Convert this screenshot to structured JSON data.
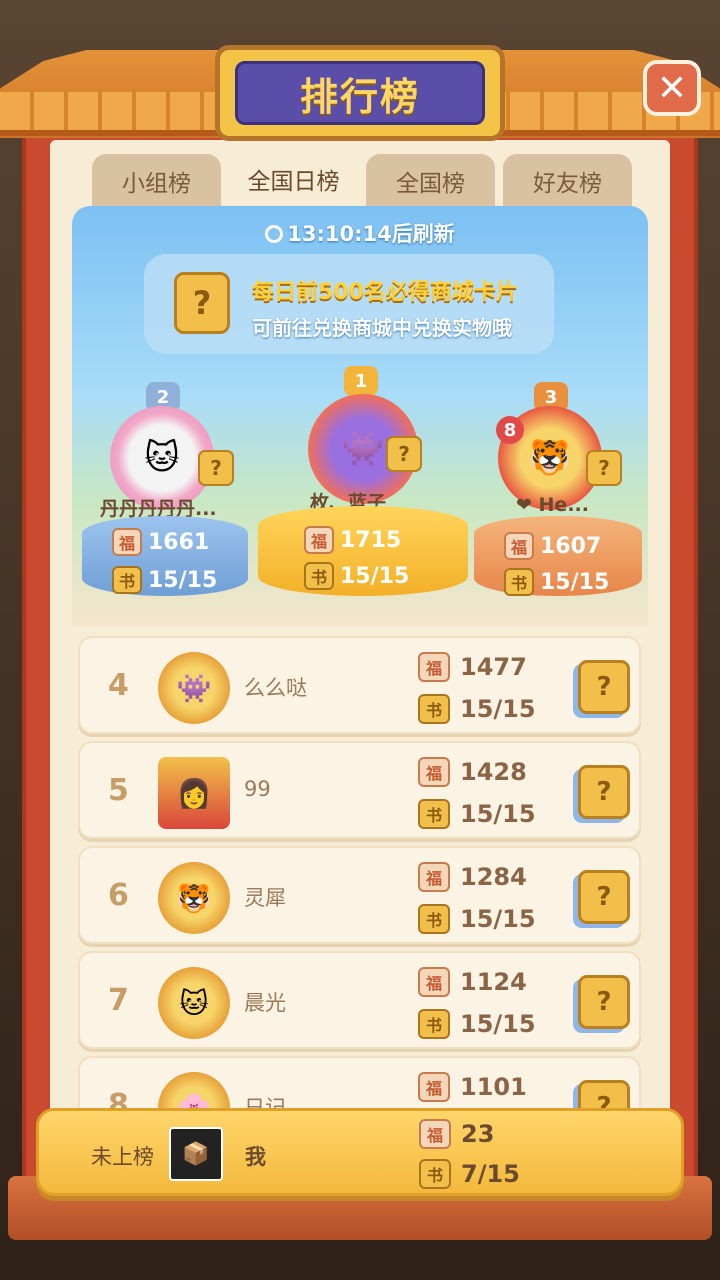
{
  "header": {
    "title": "排行榜",
    "close_icon": "close-icon"
  },
  "tabs": [
    {
      "label": "小组榜",
      "active": false
    },
    {
      "label": "全国日榜",
      "active": true
    },
    {
      "label": "全国榜",
      "active": false
    },
    {
      "label": "好友榜",
      "active": false
    }
  ],
  "refresh": {
    "text": "13:10:14后刷新"
  },
  "banner": {
    "line1": "每日前500名必得商城卡片",
    "line2": "可前往兑换商城中兑换实物哦",
    "card_mark": "?"
  },
  "podium": [
    {
      "rank": "2",
      "name": "丹丹丹丹丹...",
      "score": "1661",
      "progress": "15/15"
    },
    {
      "rank": "1",
      "name": "枚、蓝子",
      "score": "1715",
      "progress": "15/15"
    },
    {
      "rank": "3",
      "name": "❤ He...",
      "score": "1607",
      "progress": "15/15",
      "level": "8"
    }
  ],
  "list": [
    {
      "rank": "4",
      "name": "么么哒",
      "score": "1477",
      "progress": "15/15"
    },
    {
      "rank": "5",
      "name": "99",
      "score": "1428",
      "progress": "15/15"
    },
    {
      "rank": "6",
      "name": "灵犀",
      "score": "1284",
      "progress": "15/15"
    },
    {
      "rank": "7",
      "name": "晨光",
      "score": "1124",
      "progress": "15/15"
    },
    {
      "rank": "8",
      "name": "日记",
      "score": "1101",
      "progress": ""
    }
  ],
  "me": {
    "label": "未上榜",
    "name": "我",
    "score": "23",
    "progress": "7/15"
  },
  "icons": {
    "fu": "福",
    "book": "书",
    "card": "?"
  }
}
